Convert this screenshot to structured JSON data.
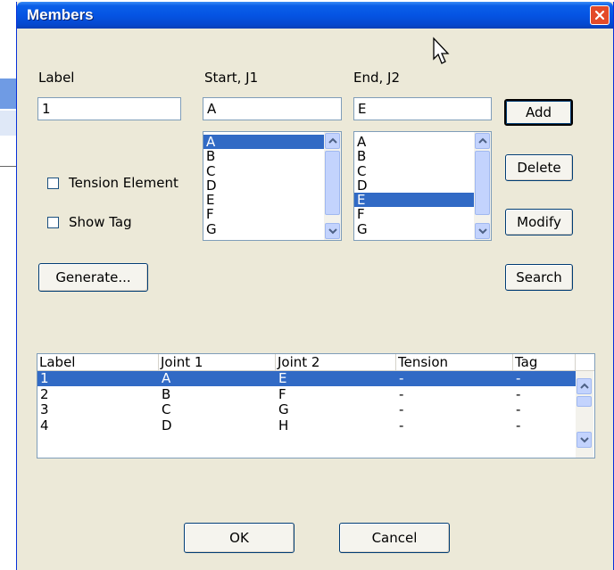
{
  "window": {
    "title": "Members"
  },
  "form": {
    "label_caption": "Label",
    "label_value": "1",
    "start_caption": "Start, J1",
    "start_value": "A",
    "end_caption": "End, J2",
    "end_value": "E"
  },
  "start_list": {
    "items": [
      "A",
      "B",
      "C",
      "D",
      "E",
      "F",
      "G"
    ],
    "selected": "A"
  },
  "end_list": {
    "items": [
      "A",
      "B",
      "C",
      "D",
      "E",
      "F",
      "G"
    ],
    "selected": "E"
  },
  "options": {
    "tension_label": "Tension Element",
    "tension_checked": false,
    "show_tag_label": "Show Tag",
    "show_tag_checked": false
  },
  "buttons": {
    "add": "Add",
    "delete": "Delete",
    "modify": "Modify",
    "search": "Search",
    "generate": "Generate...",
    "ok": "OK",
    "cancel": "Cancel"
  },
  "table": {
    "columns": [
      "Label",
      "Joint 1",
      "Joint 2",
      "Tension",
      "Tag"
    ],
    "rows": [
      [
        "1",
        "A",
        "E",
        "-",
        "-"
      ],
      [
        "2",
        "B",
        "F",
        "-",
        "-"
      ],
      [
        "3",
        "C",
        "G",
        "-",
        "-"
      ],
      [
        "4",
        "D",
        "H",
        "-",
        "-"
      ]
    ],
    "selected_row": 0
  },
  "icons": {
    "close": "close-icon",
    "scroll_up": "chevron-up-icon",
    "scroll_down": "chevron-down-icon",
    "cursor": "mouse-pointer-icon"
  },
  "colors": {
    "titlebar": "#0554e3",
    "selection": "#316ac5",
    "close_button": "#e34b2a",
    "dialog_face": "#ece9d8"
  }
}
